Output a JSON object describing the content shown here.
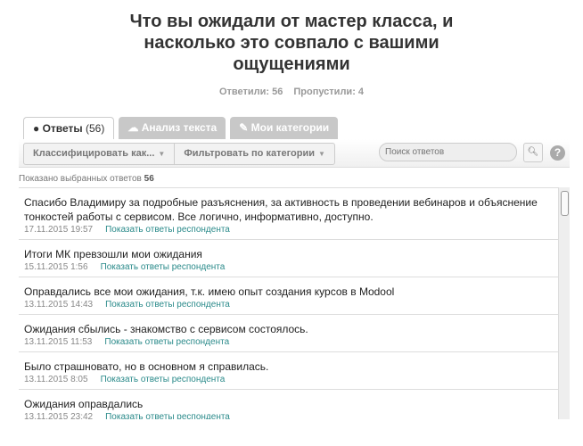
{
  "title_lines": [
    "Что вы ожидали от мастер класса, и",
    "насколько это совпало с вашими",
    "ощущениями"
  ],
  "stats": {
    "answered": "Ответили: 56",
    "skipped": "Пропустили: 4"
  },
  "tabs": [
    {
      "label": "Ответы",
      "count": "(56)",
      "icon": "speech-bubble-icon"
    },
    {
      "label": "Анализ текста",
      "icon": "cloud-icon"
    },
    {
      "label": "Мои категории",
      "icon": "tag-icon"
    }
  ],
  "toolbar": {
    "classify": "Классифицировать как...",
    "filter": "Фильтровать по категории",
    "search_placeholder": "Поиск ответов",
    "help": "?"
  },
  "shown": {
    "label": "Показано выбранных ответов",
    "count": "56"
  },
  "link_label": "Показать ответы респондента",
  "responses": [
    {
      "text": "Спасибо Владимиру за подробные разъяснения, за активность в проведении вебинаров и объяснение тонкостей работы с сервисом. Все логично, информативно, доступно.",
      "date": "17.11.2015 19:57"
    },
    {
      "text": "Итоги МК превзошли мои ожидания",
      "date": "15.11.2015 1:56"
    },
    {
      "text": "Оправдались все мои ожидания, т.к. имею опыт создания курсов в Modool",
      "date": "13.11.2015 14:43"
    },
    {
      "text": "Ожидания сбылись - знакомство с сервисом состоялось.",
      "date": "13.11.2015 11:53"
    },
    {
      "text": "Было страшновато, но в основном я справилась.",
      "date": "13.11.2015 8:05"
    },
    {
      "text": "Ожидания оправдались",
      "date": "13.11.2015 23:42"
    }
  ]
}
